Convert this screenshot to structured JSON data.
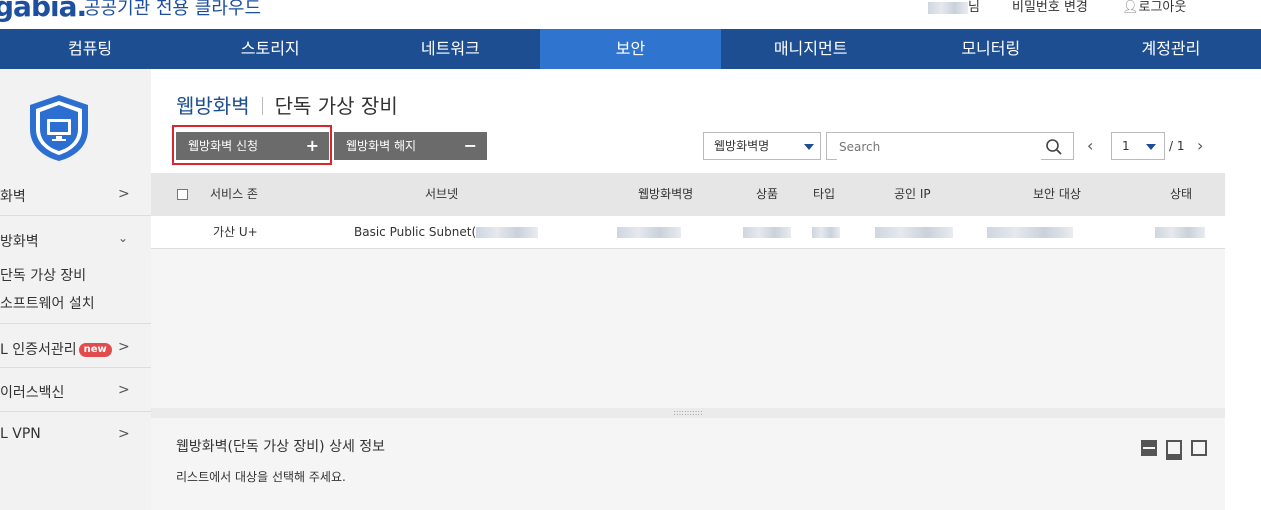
{
  "header": {
    "brand": "gabia.",
    "brand_sub": "공공기관 전용 클라우드",
    "user_suffix": "님",
    "change_password": "비밀번호 변경",
    "logout": "로그아웃"
  },
  "nav": {
    "items": [
      "컴퓨팅",
      "스토리지",
      "네트워크",
      "보안",
      "매니지먼트",
      "모니터링",
      "계정관리"
    ],
    "active": "보안"
  },
  "sidebar": {
    "items": [
      {
        "label": "화벽"
      },
      {
        "label": "방화벽"
      },
      {
        "label": "L 인증서관리",
        "badge": "new"
      },
      {
        "label": "이러스백신"
      },
      {
        "label": "L VPN"
      }
    ],
    "subitems": [
      "단독 가상 장비",
      "소프트웨어 설치"
    ]
  },
  "page": {
    "title_main": "웹방화벽",
    "title_sub": "단독 가상 장비"
  },
  "toolbar": {
    "apply_label": "웹방화벽 신청",
    "apply_symbol": "+",
    "cancel_label": "웹방화벽 해지",
    "cancel_symbol": "−",
    "filter_select": "웹방화벽명",
    "search_placeholder": "Search",
    "page_current": "1",
    "page_total": "/ 1"
  },
  "table": {
    "headers": [
      "서비스 존",
      "서브넷",
      "웹방화벽명",
      "상품",
      "타입",
      "공인 IP",
      "보안 대상",
      "상태"
    ],
    "rows": [
      {
        "zone": "가산 U+",
        "subnet": "Basic Public Subnet("
      }
    ]
  },
  "detail": {
    "title": "웹방화벽(단독 가상 장비) 상세 정보",
    "message": "리스트에서 대상을 선택해 주세요."
  },
  "colors": {
    "nav_bg": "#1d4e91",
    "nav_active": "#2f74cf",
    "highlight_outline": "#d9262c",
    "new_badge": "#e34c4c"
  }
}
